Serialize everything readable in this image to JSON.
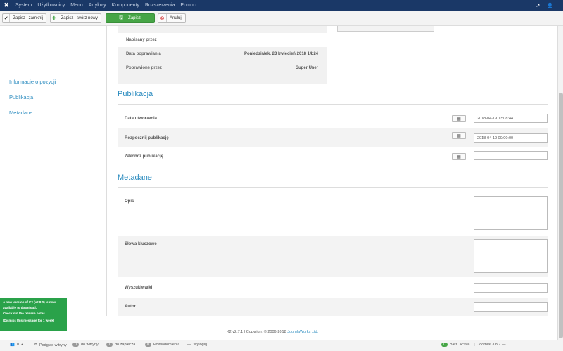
{
  "topnav": {
    "menu": [
      "System",
      "Użytkownicy",
      "Menu",
      "Artykuły",
      "Komponenty",
      "Rozszerzenia",
      "Pomoc"
    ],
    "right_icons": [
      "external-link-icon",
      "user-icon"
    ]
  },
  "toolbar": {
    "save_close_label": "Zapisz i zamknij",
    "save_new_label": "Zapisz i twórz nowy",
    "save_label": "Zapisz",
    "cancel_label": "Anuluj"
  },
  "sidebar": {
    "items": [
      "Informacje o pozycji",
      "Publikacja",
      "Metadane"
    ]
  },
  "info": {
    "rows": [
      {
        "label": "Napisany przez",
        "value": ""
      },
      {
        "label": "Data poprawiania",
        "value": "Poniedziałek, 23 kwiecień 2018 14:24"
      },
      {
        "label": "Poprawione przez",
        "value": "Super User"
      }
    ]
  },
  "publikacja": {
    "title": "Publikacja",
    "fields": [
      {
        "label": "Data utworzenia",
        "value": "2018-04-19 13:08:44"
      },
      {
        "label": "Rozpocznij publikację",
        "value": "2018-04-19 00:00:00"
      },
      {
        "label": "Zakończ publikację",
        "value": ""
      }
    ]
  },
  "metadane": {
    "title": "Metadane",
    "fields": [
      {
        "label": "Opis"
      },
      {
        "label": "Słowa kluczowe"
      },
      {
        "label": "Wyszukiwarki"
      },
      {
        "label": "Autor"
      }
    ]
  },
  "footer": {
    "copy_prefix": "K2 v2.7.1 | Copyright © 2006-2018",
    "copy_link": "JoomlaWorks Ltd."
  },
  "notice": {
    "line1": "A new version of K2 (v2.8.0) is now",
    "line2": "available to download.",
    "line3": "Check out the release notes.",
    "line4": "[Dismiss this message for 1 week]"
  },
  "statusbar": {
    "users_count": "0",
    "site_label": "Podgląd witryny",
    "visitors_count": "0",
    "visitors_label": "do witryny",
    "admins_count": "1",
    "admins_label": "do zaplecza",
    "messages_count": "0",
    "messages_label": "Powiadomienia",
    "logout_label": "Wyloguj",
    "active_count": "0",
    "active_label": "Bież. Active",
    "version": "Joomla! 3.8.7 —"
  }
}
